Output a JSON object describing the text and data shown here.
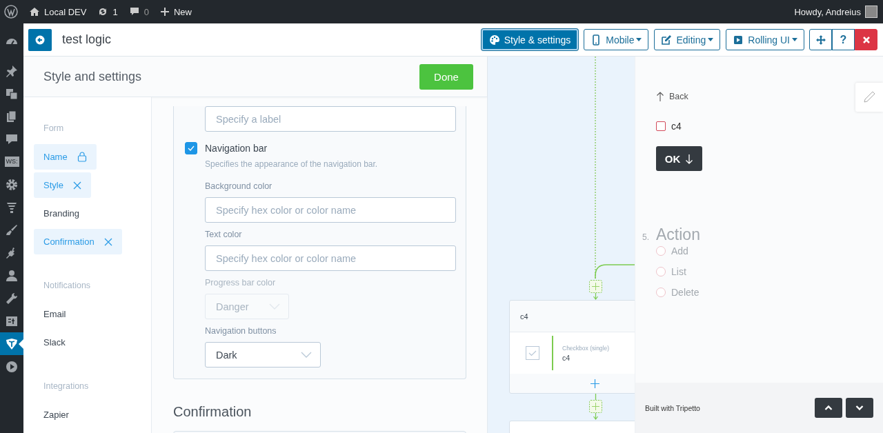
{
  "admin_bar": {
    "site": "Local DEV",
    "updates": "1",
    "comments": "0",
    "new": "New",
    "greeting": "Howdy, Andreius"
  },
  "admin_menu": [
    {
      "kind": "dashboard",
      "selected": false
    },
    {
      "kind": "pin",
      "selected": false
    },
    {
      "kind": "media",
      "selected": false
    },
    {
      "kind": "pages",
      "selected": false
    },
    {
      "kind": "comments",
      "selected": false
    },
    {
      "kind": "text",
      "label": "WS:",
      "selected": false
    },
    {
      "kind": "gear",
      "selected": false
    },
    {
      "kind": "funnel",
      "selected": false
    },
    {
      "kind": "brush",
      "selected": false
    },
    {
      "kind": "plug",
      "selected": false
    },
    {
      "kind": "user",
      "selected": false
    },
    {
      "kind": "wrench",
      "selected": false
    },
    {
      "kind": "panel",
      "selected": false
    },
    {
      "kind": "tripetto",
      "selected": true
    },
    {
      "kind": "play",
      "selected": false
    }
  ],
  "header": {
    "title": "test logic",
    "buttons": [
      {
        "kind": "palette",
        "label": "Style & settings",
        "selected": true,
        "dropdown": false
      },
      {
        "kind": "phone",
        "label": "Mobile",
        "selected": false,
        "dropdown": true
      },
      {
        "kind": "edit",
        "label": "Editing",
        "selected": false,
        "dropdown": true
      },
      {
        "kind": "play",
        "label": "Rolling UI",
        "selected": false,
        "dropdown": true
      }
    ],
    "tools": [
      {
        "kind": "move"
      },
      {
        "kind": "help",
        "label": "?"
      },
      {
        "kind": "close"
      }
    ]
  },
  "settings": {
    "title": "Style and settings",
    "done": "Done",
    "nav": [
      {
        "kind": "heading",
        "label": "Form"
      },
      {
        "kind": "item",
        "label": "Name",
        "enabled": true,
        "locked": true
      },
      {
        "kind": "item",
        "label": "Style",
        "enabled": true,
        "removable": true
      },
      {
        "kind": "item",
        "label": "Branding",
        "enabled": false
      },
      {
        "kind": "item",
        "label": "Confirmation",
        "enabled": true,
        "removable": true
      },
      {
        "kind": "heading",
        "label": "Notifications"
      },
      {
        "kind": "item",
        "label": "Email",
        "enabled": false
      },
      {
        "kind": "item",
        "label": "Slack",
        "enabled": false
      },
      {
        "kind": "heading",
        "label": "Integrations"
      },
      {
        "kind": "item",
        "label": "Zapier",
        "enabled": false
      }
    ],
    "fields": [
      {
        "kind": "input",
        "placeholder": "Specify a label"
      },
      {
        "kind": "checkbox",
        "label": "Navigation bar",
        "checked": true,
        "description": "Specifies the appearance of the navigation bar."
      },
      {
        "kind": "label",
        "text": "Background color",
        "disabled": false
      },
      {
        "kind": "input",
        "placeholder": "Specify hex color or color name"
      },
      {
        "kind": "label",
        "text": "Text color",
        "disabled": false
      },
      {
        "kind": "input",
        "placeholder": "Specify hex color or color name"
      },
      {
        "kind": "label",
        "text": "Progress bar color",
        "disabled": true
      },
      {
        "kind": "select",
        "value": "Danger",
        "disabled": true
      },
      {
        "kind": "label",
        "text": "Navigation buttons",
        "disabled": false
      },
      {
        "kind": "select",
        "value": "Dark",
        "disabled": false
      }
    ],
    "section": "Confirmation"
  },
  "canvas": {
    "cards": [
      {
        "title": "c4",
        "blocks": [
          {
            "type": "Checkbox (single)",
            "name": "c4"
          }
        ]
      }
    ]
  },
  "preview": {
    "back": "Back",
    "checkbox": {
      "label": "c4",
      "checked": false
    },
    "ok": "OK",
    "question": {
      "number": "5.",
      "title": "Action",
      "active": false,
      "options": [
        {
          "label": "Add",
          "selected": false
        },
        {
          "label": "List",
          "selected": false
        },
        {
          "label": "Delete",
          "selected": false
        }
      ]
    },
    "footer": "Built with Tripetto"
  }
}
